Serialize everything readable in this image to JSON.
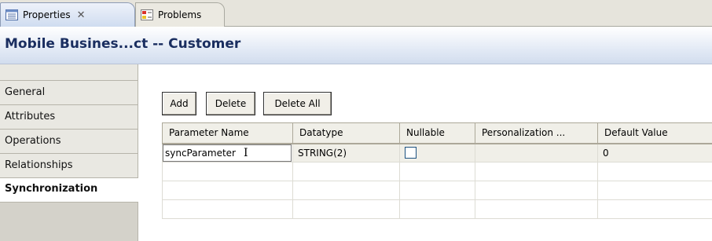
{
  "tabs": [
    {
      "label": "Properties",
      "icon": "properties-view-icon",
      "active": true,
      "close_glyph": "✕"
    },
    {
      "label": "Problems",
      "icon": "problems-view-icon",
      "active": false
    }
  ],
  "title": "Mobile Busines...ct -- Customer",
  "nav": {
    "items": [
      {
        "label": "General",
        "selected": false
      },
      {
        "label": "Attributes",
        "selected": false
      },
      {
        "label": "Operations",
        "selected": false
      },
      {
        "label": "Relationships",
        "selected": false
      },
      {
        "label": "Synchronization",
        "selected": true
      }
    ]
  },
  "toolbar": {
    "add_label": "Add",
    "delete_label": "Delete",
    "delete_all_label": "Delete All"
  },
  "table": {
    "columns": [
      "Parameter Name",
      "Datatype",
      "Nullable",
      "Personalization ...",
      "Default Value"
    ],
    "rows": [
      {
        "parameter_name": "syncParameter",
        "datatype": "STRING(2)",
        "nullable": false,
        "personalization": "",
        "default_value": "0"
      }
    ],
    "empty_rows": 3
  },
  "colors": {
    "title_text": "#1a2e60",
    "tab_active_bg": "#cfdcf0",
    "nav_bg": "#e9e8e2"
  }
}
